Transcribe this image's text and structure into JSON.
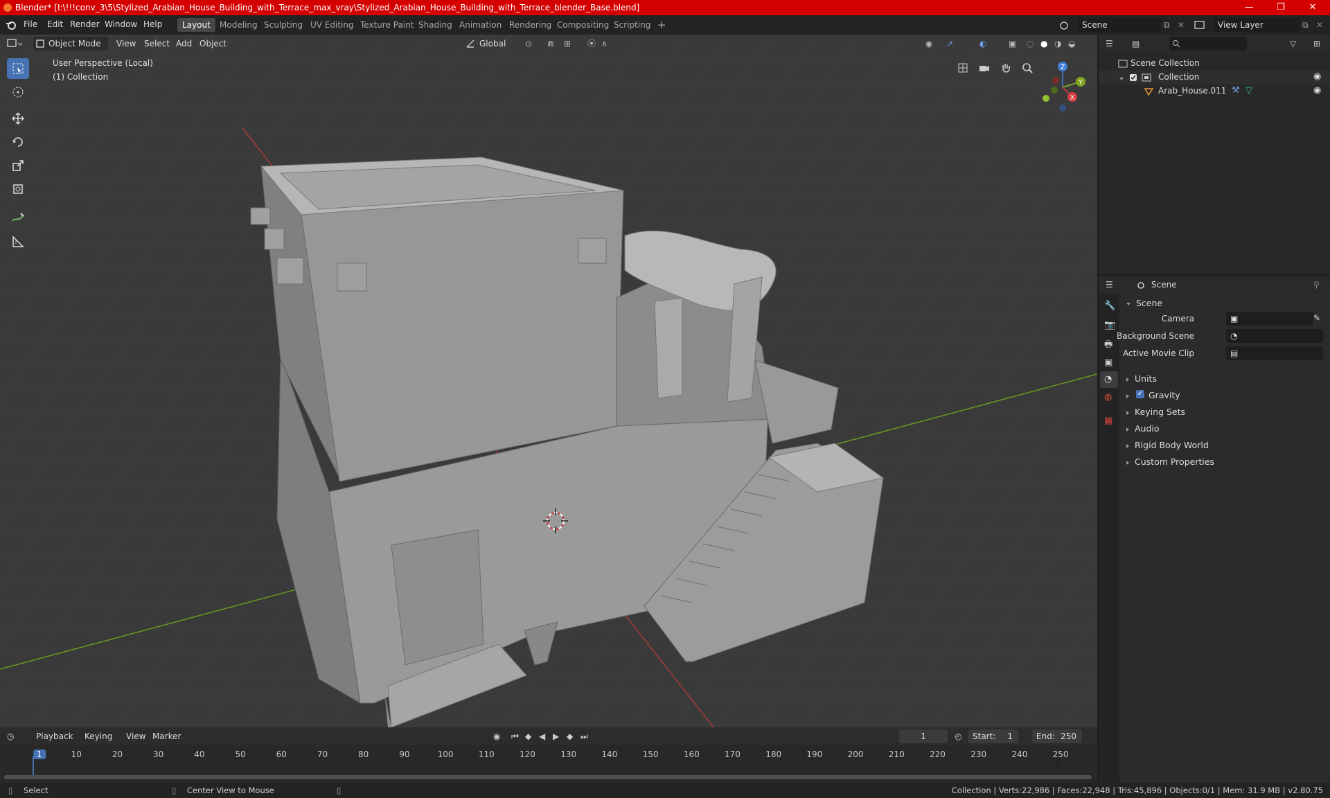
{
  "window": {
    "title": "Blender* [I:\\!!!conv_3\\5\\Stylized_Arabian_House_Building_with_Terrace_max_vray\\Stylized_Arabian_House_Building_with_Terrace_blender_Base.blend]",
    "controls": [
      "—",
      "❐",
      "✕"
    ]
  },
  "menu": {
    "items": [
      "File",
      "Edit",
      "Render",
      "Window",
      "Help"
    ],
    "workspaces": [
      "Layout",
      "Modeling",
      "Sculpting",
      "UV Editing",
      "Texture Paint",
      "Shading",
      "Animation",
      "Rendering",
      "Compositing",
      "Scripting"
    ],
    "active_workspace": "Layout",
    "scene_name": "Scene",
    "view_layer": "View Layer"
  },
  "viewport": {
    "mode": "Object Mode",
    "menus": [
      "View",
      "Select",
      "Add",
      "Object"
    ],
    "transform_orientation": "Global",
    "overlay_text_1": "User Perspective (Local)",
    "overlay_text_2": "(1) Collection",
    "gizmo_axes": [
      "Z",
      "Y",
      "X"
    ]
  },
  "outliner": {
    "root": "Scene Collection",
    "collection": "Collection",
    "object": "Arab_House.011"
  },
  "properties": {
    "context": "Scene",
    "panel": "Scene",
    "fields": [
      {
        "label": "Camera",
        "value": ""
      },
      {
        "label": "Background Scene",
        "value": ""
      },
      {
        "label": "Active Movie Clip",
        "value": ""
      }
    ],
    "sections": [
      "Units",
      "Gravity",
      "Keying Sets",
      "Audio",
      "Rigid Body World",
      "Custom Properties"
    ]
  },
  "timeline": {
    "menus": [
      "Playback",
      "Keying",
      "View",
      "Marker"
    ],
    "current_frame": "1",
    "start_label": "Start:",
    "start": "1",
    "end_label": "End:",
    "end": "250",
    "ticks": [
      "1",
      "10",
      "20",
      "30",
      "40",
      "50",
      "60",
      "70",
      "80",
      "90",
      "100",
      "110",
      "120",
      "130",
      "140",
      "150",
      "160",
      "170",
      "180",
      "190",
      "200",
      "210",
      "220",
      "230",
      "240",
      "250"
    ]
  },
  "statusbar": {
    "left": "Select",
    "middle": "Center View to Mouse",
    "right": "Collection | Verts:22,986 | Faces:22,948 | Tris:45,896 | Objects:0/1 | Mem: 31.9 MB | v2.80.75"
  },
  "colors": {
    "titlebar": "#d40000",
    "accent": "#4772b3",
    "viewport_bg": "#393939",
    "axis_x": "#c0392b",
    "axis_y": "#6a9a1f"
  }
}
